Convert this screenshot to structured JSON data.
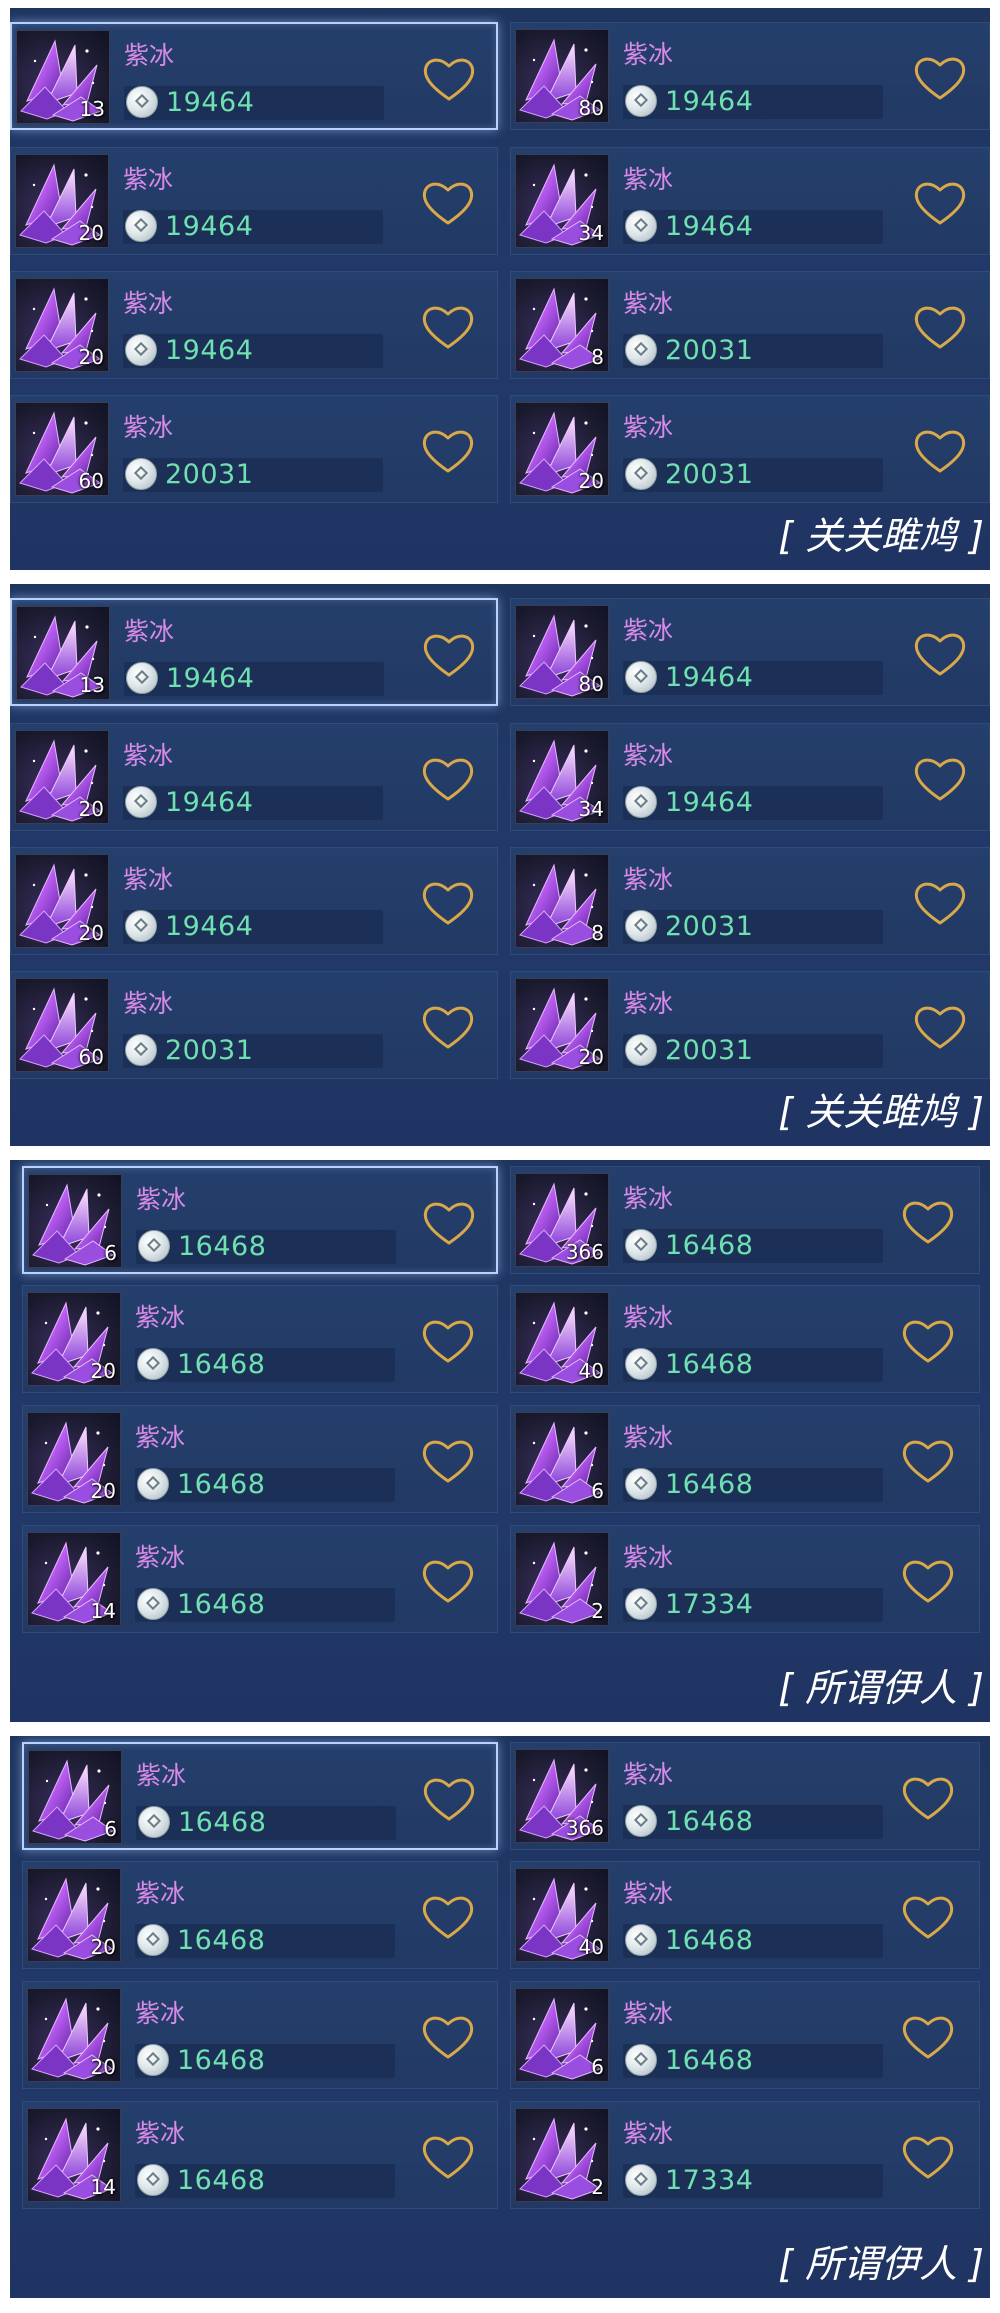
{
  "crystal_icon": "purple-crystal-icon",
  "coin_icon": "silver-coin-icon",
  "favorite_icon": "heart-outline-icon",
  "colors": {
    "name": "#d98ae8",
    "price": "#6fe0b0",
    "heart": "#d8a84a",
    "panel": "#22396a"
  },
  "panels": [
    {
      "seller": "[ 关关雎鸠 ]",
      "items": [
        {
          "name": "紫冰",
          "qty": "13",
          "price": "19464",
          "selected": true
        },
        {
          "name": "紫冰",
          "qty": "80",
          "price": "19464",
          "selected": false
        },
        {
          "name": "紫冰",
          "qty": "20",
          "price": "19464",
          "selected": false
        },
        {
          "name": "紫冰",
          "qty": "34",
          "price": "19464",
          "selected": false
        },
        {
          "name": "紫冰",
          "qty": "20",
          "price": "19464",
          "selected": false
        },
        {
          "name": "紫冰",
          "qty": "8",
          "price": "20031",
          "selected": false
        },
        {
          "name": "紫冰",
          "qty": "60",
          "price": "20031",
          "selected": false
        },
        {
          "name": "紫冰",
          "qty": "20",
          "price": "20031",
          "selected": false
        }
      ]
    },
    {
      "seller": "[ 关关雎鸠 ]",
      "items": [
        {
          "name": "紫冰",
          "qty": "13",
          "price": "19464",
          "selected": true
        },
        {
          "name": "紫冰",
          "qty": "80",
          "price": "19464",
          "selected": false
        },
        {
          "name": "紫冰",
          "qty": "20",
          "price": "19464",
          "selected": false
        },
        {
          "name": "紫冰",
          "qty": "34",
          "price": "19464",
          "selected": false
        },
        {
          "name": "紫冰",
          "qty": "20",
          "price": "19464",
          "selected": false
        },
        {
          "name": "紫冰",
          "qty": "8",
          "price": "20031",
          "selected": false
        },
        {
          "name": "紫冰",
          "qty": "60",
          "price": "20031",
          "selected": false
        },
        {
          "name": "紫冰",
          "qty": "20",
          "price": "20031",
          "selected": false
        }
      ]
    },
    {
      "seller": "[ 所谓伊人 ]",
      "items": [
        {
          "name": "紫冰",
          "qty": "6",
          "price": "16468",
          "selected": true
        },
        {
          "name": "紫冰",
          "qty": "366",
          "price": "16468",
          "selected": false
        },
        {
          "name": "紫冰",
          "qty": "20",
          "price": "16468",
          "selected": false
        },
        {
          "name": "紫冰",
          "qty": "40",
          "price": "16468",
          "selected": false
        },
        {
          "name": "紫冰",
          "qty": "20",
          "price": "16468",
          "selected": false
        },
        {
          "name": "紫冰",
          "qty": "6",
          "price": "16468",
          "selected": false
        },
        {
          "name": "紫冰",
          "qty": "14",
          "price": "16468",
          "selected": false
        },
        {
          "name": "紫冰",
          "qty": "2",
          "price": "17334",
          "selected": false
        }
      ]
    },
    {
      "seller": "[ 所谓伊人 ]",
      "items": [
        {
          "name": "紫冰",
          "qty": "6",
          "price": "16468",
          "selected": true
        },
        {
          "name": "紫冰",
          "qty": "366",
          "price": "16468",
          "selected": false
        },
        {
          "name": "紫冰",
          "qty": "20",
          "price": "16468",
          "selected": false
        },
        {
          "name": "紫冰",
          "qty": "40",
          "price": "16468",
          "selected": false
        },
        {
          "name": "紫冰",
          "qty": "20",
          "price": "16468",
          "selected": false
        },
        {
          "name": "紫冰",
          "qty": "6",
          "price": "16468",
          "selected": false
        },
        {
          "name": "紫冰",
          "qty": "14",
          "price": "16468",
          "selected": false
        },
        {
          "name": "紫冰",
          "qty": "2",
          "price": "17334",
          "selected": false
        }
      ]
    }
  ]
}
